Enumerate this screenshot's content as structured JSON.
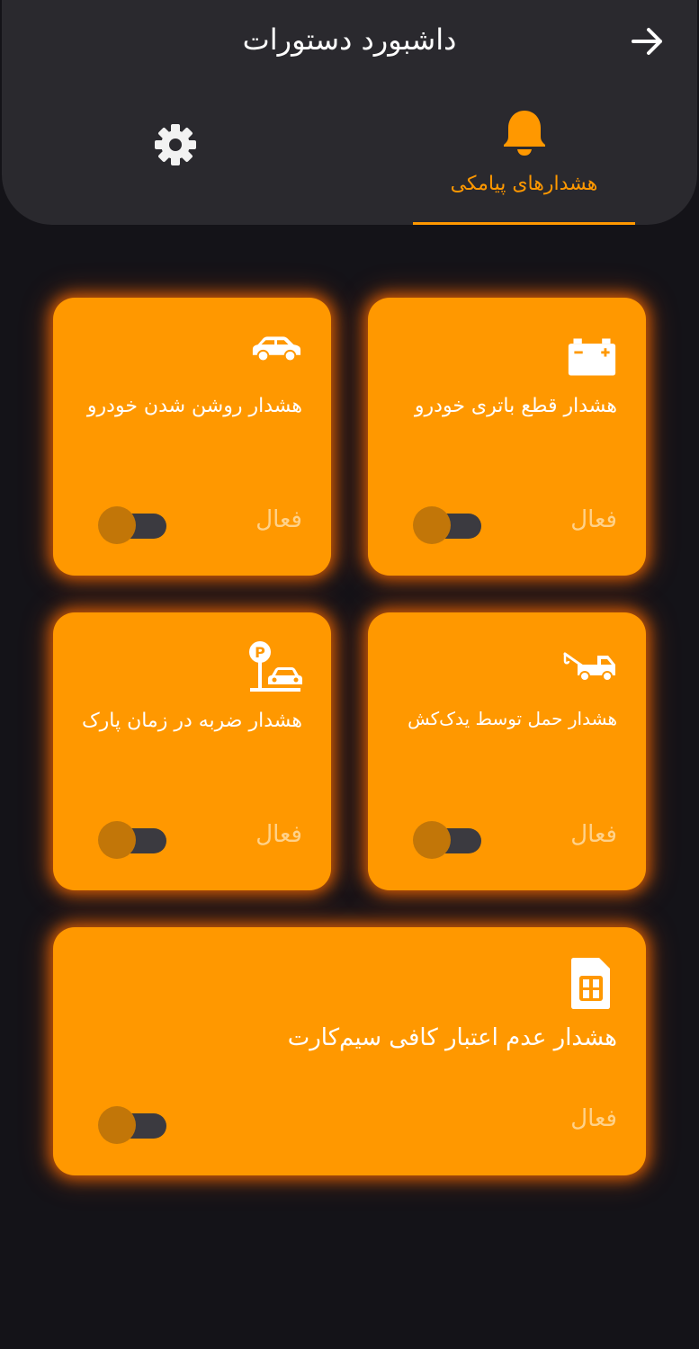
{
  "header": {
    "title": "داشبورد دستورات",
    "back_icon": "arrow-right-icon"
  },
  "tabs": [
    {
      "label": "هشدارهای پیامکی",
      "icon": "bell-icon",
      "selected": true
    },
    {
      "label": "",
      "icon": "gear-icon",
      "selected": false
    }
  ],
  "colors": {
    "accent": "#ff9800",
    "background": "#141318",
    "header": "#2a292e",
    "toggle_track": "#3b3a40",
    "toggle_knob": "#c27608"
  },
  "alerts": [
    {
      "title": "هشدار قطع باتری خودرو",
      "status_label": "فعال",
      "icon": "car-battery-icon",
      "enabled": false
    },
    {
      "title": "هشدار روشن شدن خودرو",
      "status_label": "فعال",
      "icon": "car-icon",
      "enabled": false
    },
    {
      "title": "هشدار حمل توسط یدک‌کش",
      "status_label": "فعال",
      "icon": "tow-truck-icon",
      "enabled": false
    },
    {
      "title": "هشدار ضربه در زمان پارک",
      "status_label": "فعال",
      "icon": "parking-car-icon",
      "enabled": false
    },
    {
      "title": "هشدار عدم اعتبار کافی سیم‌کارت",
      "status_label": "فعال",
      "icon": "sim-card-icon",
      "enabled": false
    }
  ]
}
